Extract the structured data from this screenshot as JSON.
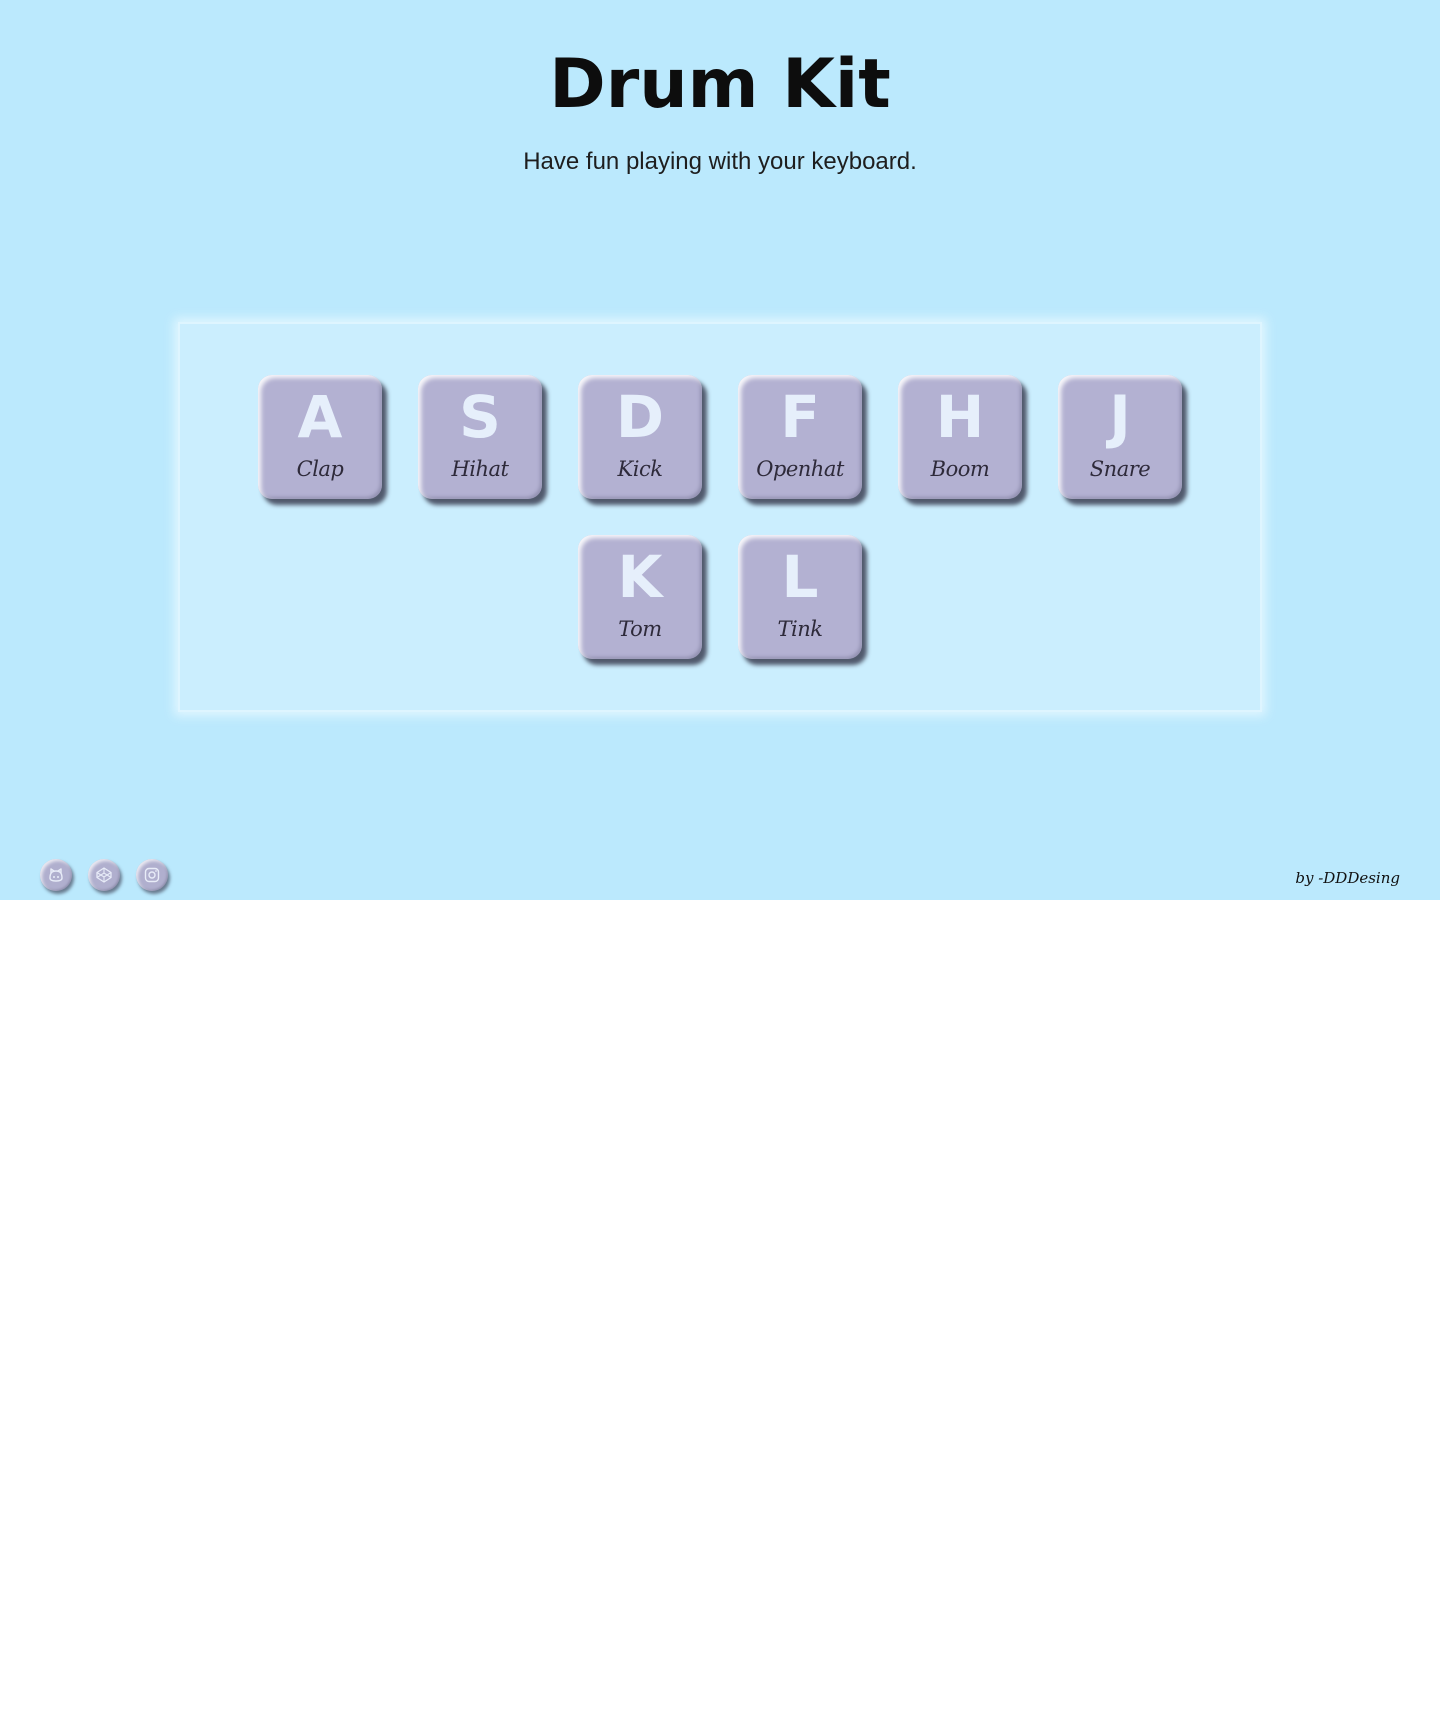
{
  "page": {
    "title": "Drum Kit",
    "subtitle": "Have fun playing with your keyboard.",
    "background_color": "#bbe9fd",
    "key_color": "#b3b1d2"
  },
  "keys": [
    {
      "letter": "A",
      "sound": "Clap"
    },
    {
      "letter": "S",
      "sound": "Hihat"
    },
    {
      "letter": "D",
      "sound": "Kick"
    },
    {
      "letter": "F",
      "sound": "Openhat"
    },
    {
      "letter": "H",
      "sound": "Boom"
    },
    {
      "letter": "J",
      "sound": "Snare"
    },
    {
      "letter": "K",
      "sound": "Tom"
    },
    {
      "letter": "L",
      "sound": "Tink"
    }
  ],
  "footer": {
    "social_icons": [
      "github-icon",
      "codepen-icon",
      "instagram-icon"
    ],
    "credit": "by -DDDesing"
  }
}
